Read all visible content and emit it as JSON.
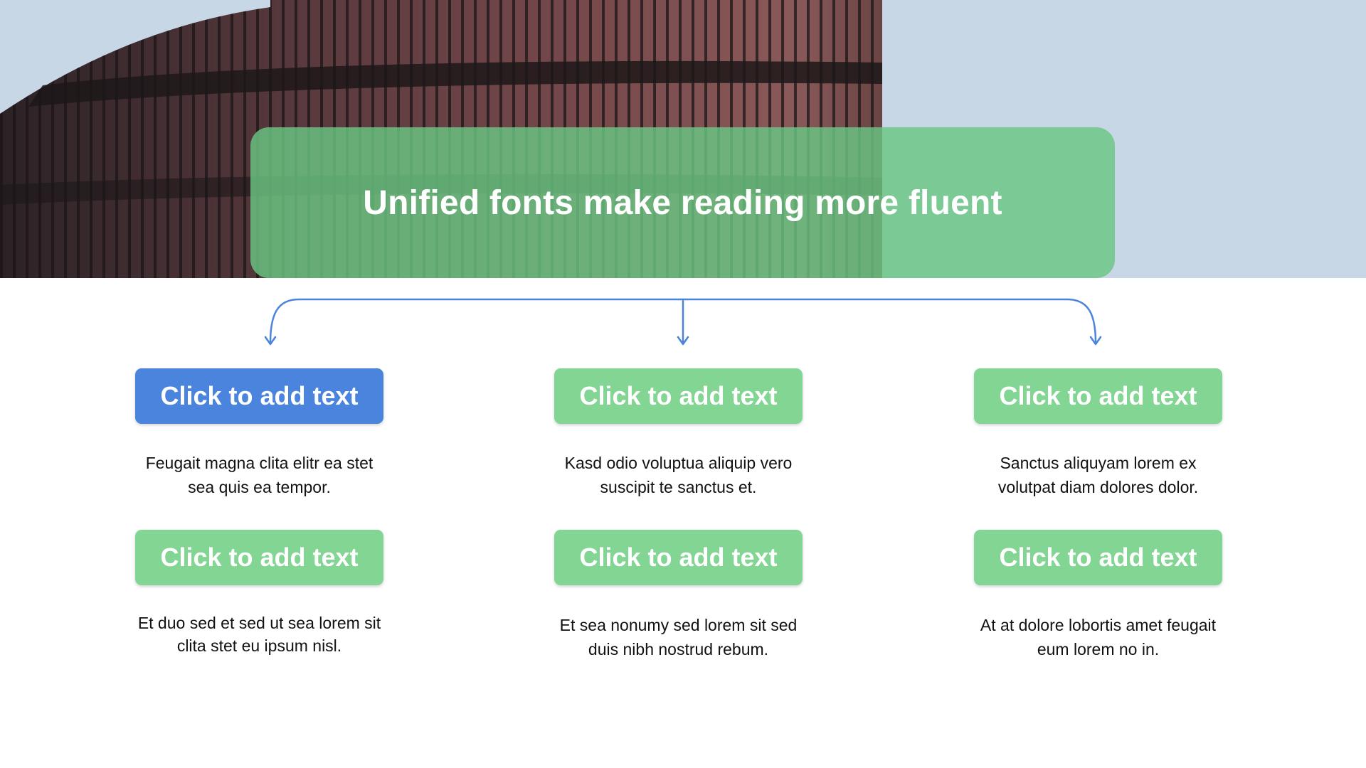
{
  "title": "Unified fonts make reading more fluent",
  "colors": {
    "blue": "#4a84dd",
    "green": "#82d593",
    "banner_green": "#6ac682",
    "connector": "#4a84dd"
  },
  "columns": [
    {
      "top_button": "Click to add text",
      "top_text": "Feugait magna clita elitr ea stet sea quis ea tempor.",
      "bottom_button": "Click to add text",
      "bottom_text": "Et duo sed et sed ut sea lorem sit clita stet eu ipsum nisl."
    },
    {
      "top_button": "Click to add text",
      "top_text": "Kasd odio voluptua aliquip vero suscipit te sanctus et.",
      "bottom_button": "Click to add text",
      "bottom_text": "Et sea nonumy sed lorem sit sed duis nibh nostrud rebum."
    },
    {
      "top_button": "Click to add text",
      "top_text": "Sanctus aliquyam lorem ex volutpat diam dolores dolor.",
      "bottom_button": "Click to add text",
      "bottom_text": "At at dolore lobortis amet feugait eum lorem no in."
    }
  ]
}
